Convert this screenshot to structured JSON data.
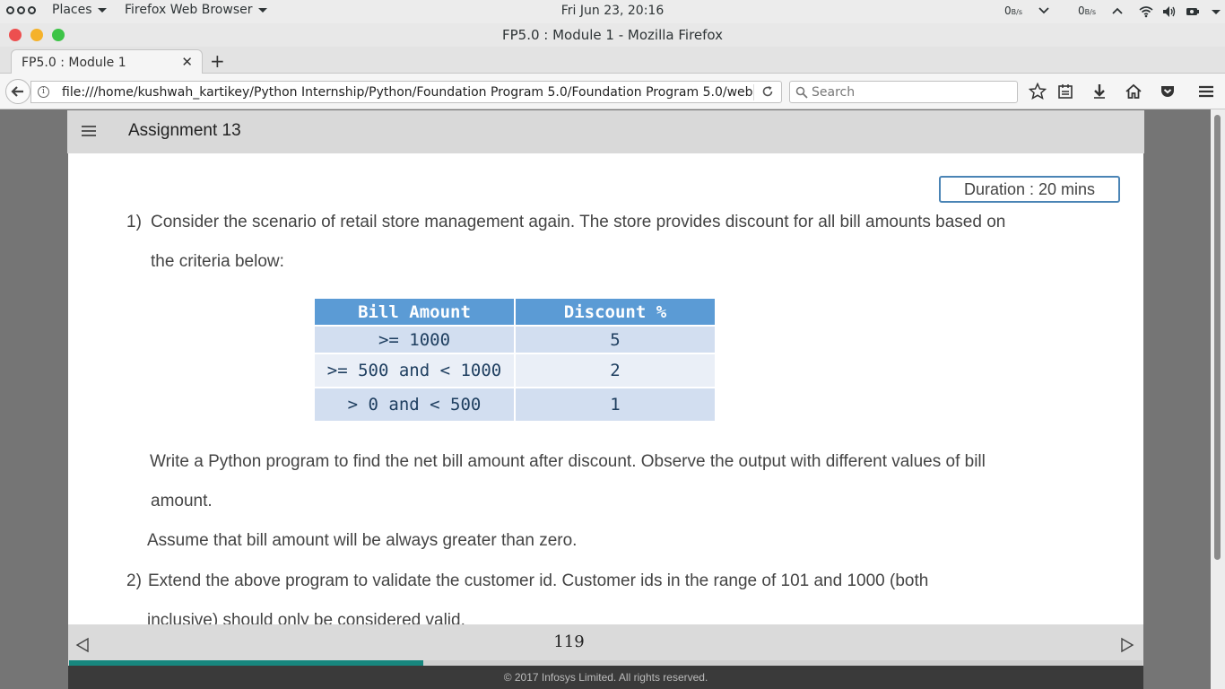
{
  "system_bar": {
    "places_label": "Places",
    "app_menu_label": "Firefox Web Browser",
    "clock": "Fri Jun 23, 20:16",
    "net_down": "0",
    "net_down_unit": "B/s",
    "net_up": "0",
    "net_up_unit": "B/s"
  },
  "window": {
    "title": "FP5.0 : Module 1 - Mozilla Firefox"
  },
  "tabs": [
    {
      "label": "FP5.0 : Module 1"
    }
  ],
  "navbar": {
    "url": "file:///home/kushwah_kartikey/Python Internship/Python/Foundation Program 5.0/Foundation Program 5.0/web/Mod",
    "search_placeholder": "Search"
  },
  "app": {
    "title": "Assignment 13",
    "duration": "Duration : 20 mins"
  },
  "questions": {
    "q1": {
      "number": "1)",
      "line1": "Consider the scenario of retail store management again. The store provides discount for all bill amounts based on",
      "line2": "the criteria below:",
      "line3": "Write a Python program to find the net bill amount after discount. Observe the output with different values of bill",
      "line4": "amount.",
      "line5": "Assume that bill amount will be always greater than zero."
    },
    "q2": {
      "number": "2)",
      "line1": "Extend the above program to validate the customer id. Customer ids in the range of 101 and 1000 (both",
      "line2": "inclusive) should only be considered valid."
    }
  },
  "discount_table": {
    "headers": [
      "Bill Amount",
      "Discount %"
    ],
    "rows": [
      [
        ">= 1000",
        "5"
      ],
      [
        ">= 500 and < 1000",
        "2"
      ],
      [
        "> 0 and < 500",
        "1"
      ]
    ]
  },
  "footer": {
    "page_number": "119",
    "progress_percent": 33,
    "copyright": "© 2017 Infosys Limited. All rights reserved."
  },
  "colors": {
    "table_header": "#5b9bd5",
    "progress": "#17877e",
    "duration_border": "#4a84b5"
  }
}
